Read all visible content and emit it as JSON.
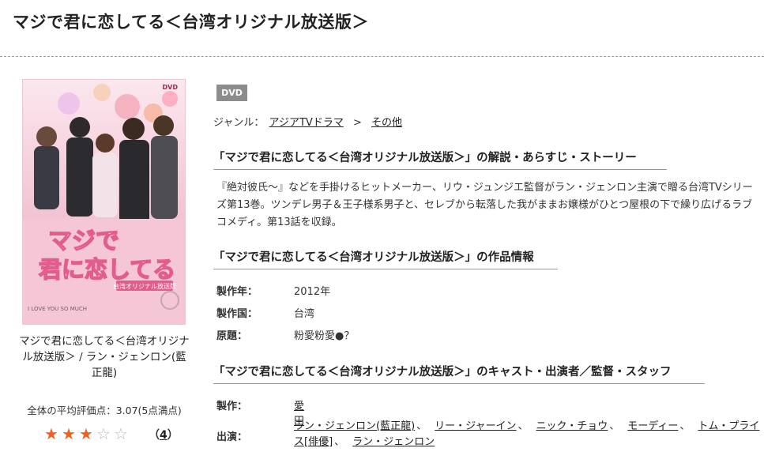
{
  "page": {
    "title": "マジで君に恋してる＜台湾オリジナル放送版＞"
  },
  "cover": {
    "title_line1": "マジで",
    "title_line2": "君に恋してる",
    "subtitle_badge": "台湾オリジナル放送版",
    "corner_text": "I LOVE YOU SO MUCH",
    "dvd_mark": "DVD",
    "caption_title": "マジで君に恋してる＜台湾オリジナル放送版＞",
    "caption_sep": " / ",
    "caption_actor": "ラン・ジェンロン(藍正龍)"
  },
  "rating": {
    "label": "全体の平均評価点：3.07(5点満点)",
    "stars_filled": 3,
    "stars_total": 5,
    "count_open": "（",
    "count": "4",
    "count_close": "）"
  },
  "media_badge": "DVD",
  "genre": {
    "label": "ジャンル：",
    "items": [
      "アジアTVドラマ",
      "その他"
    ],
    "separator": ">"
  },
  "sections": {
    "story_heading": "「マジで君に恋してる＜台湾オリジナル放送版＞」の解説・あらすじ・ストーリー",
    "story_text": "『絶対彼氏～』などを手掛けるヒットメーカー、リウ・ジュンジエ監督がラン・ジェンロン主演で贈る台湾TVシリーズ第13巻。ツンデレ男子＆王子様系男子と、セレブから転落した我がままお嬢様がひとつ屋根の下で繰り広げるラブコメディ。第13話を収録。",
    "info_heading": "「マジで君に恋してる＜台湾オリジナル放送版＞」の作品情報",
    "cast_heading": "「マジで君に恋してる＜台湾オリジナル放送版＞」のキャスト・出演者／監督・スタッフ"
  },
  "info": [
    {
      "label": "製作年：",
      "value": "2012年"
    },
    {
      "label": "製作国：",
      "value": "台湾"
    },
    {
      "label": "原題：",
      "value": "粉愛粉愛●？"
    }
  ],
  "cast": {
    "producer_label": "製作：",
    "producer": "愛田",
    "cast_label": "出演：",
    "members": [
      "ラン・ジェンロン(藍正龍)",
      "リー・ジャーイン",
      "ニック・チョウ",
      "モーディー",
      "トム・プライス[俳優]",
      "ラン・ジェンロン"
    ],
    "separator": "、"
  },
  "colors": {
    "star_on": "#f06020",
    "star_off": "#bbbbbb",
    "badge_bg": "#8c8c8c",
    "cover_pink": "#f7d7e3"
  }
}
